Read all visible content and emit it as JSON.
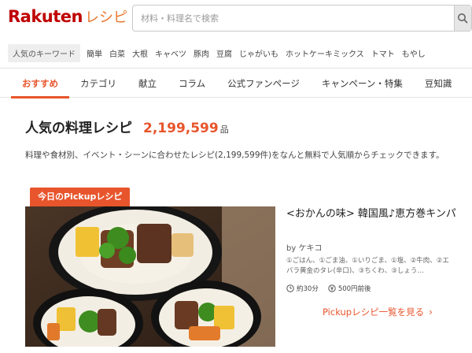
{
  "header": {
    "logo_main": "Rakuten",
    "logo_sub": "レシピ",
    "search_placeholder": "材料・料理名で検索"
  },
  "keywords": {
    "label": "人気のキーワード",
    "items": [
      "簡単",
      "白菜",
      "大根",
      "キャベツ",
      "豚肉",
      "豆腐",
      "じゃがいも",
      "ホットケーキミックス",
      "トマト",
      "もやし"
    ]
  },
  "nav": {
    "tabs": [
      "おすすめ",
      "カテゴリ",
      "献立",
      "コラム",
      "公式ファンページ",
      "キャンペーン・特集",
      "豆知識"
    ],
    "active_index": 0
  },
  "main": {
    "title": "人気の料理レシピ",
    "count": "2,199,599",
    "count_unit": "品",
    "description": "料理や食材別、イベント・シーンに合わせたレシピ(2,199,599件)をなんと無料で人気順からチェックできます。"
  },
  "pickup": {
    "badge": "今日のPickupレシピ",
    "recipe_title": "<おかんの味> 韓国風♪恵方巻キンパ",
    "author_prefix": "by",
    "author": "ケキコ",
    "ingredients": "①ごはん、①ごま油、①いりごま、①塩、②牛肉、②エバラ黄金のタレ(辛口)、③ちくわ、③しょう…",
    "time": "約30分",
    "cost": "500円前後",
    "list_link": "Pickupレシピ一覧を見る"
  },
  "colors": {
    "brand_red": "#bf0000",
    "accent_orange": "#e8552c"
  }
}
